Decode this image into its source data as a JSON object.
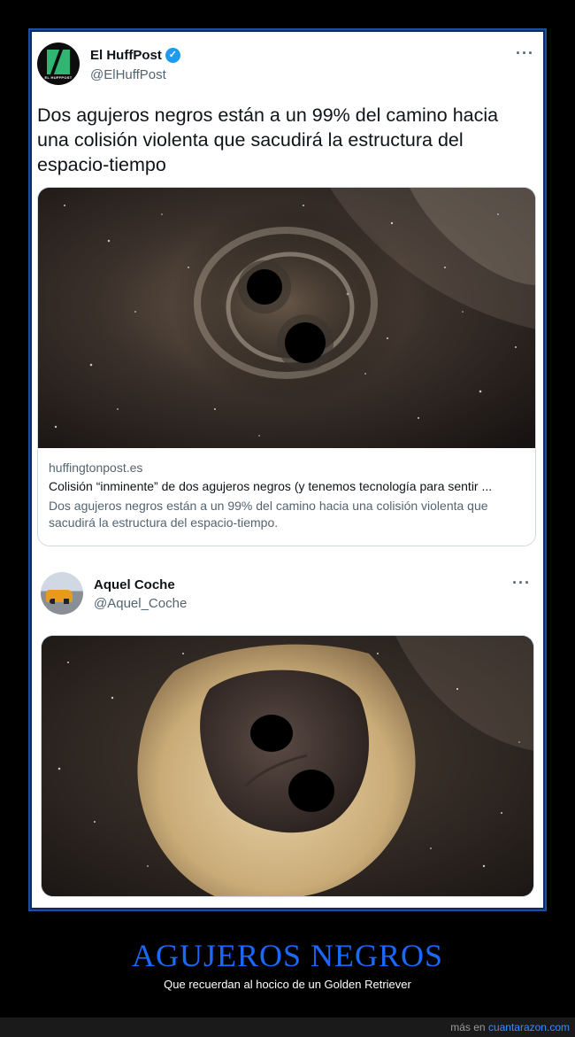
{
  "tweet1": {
    "name": "El HuffPost",
    "verified_mark": "✓",
    "handle": "@ElHuffPost",
    "more": "···",
    "avatar_small_text": "EL HUFFPOST",
    "text": "Dos agujeros negros están a un 99% del camino hacia una colisión violenta que sacudirá la estructura del espacio-tiempo",
    "link_card": {
      "domain": "huffingtonpost.es",
      "title": "Colisión “inminente” de dos agujeros negros (y tenemos tecnología para sentir ...",
      "description": "Dos agujeros negros están a un 99% del camino hacia una colisión violenta que sacudirá la estructura del espacio-tiempo."
    }
  },
  "tweet2": {
    "name": "Aquel Coche",
    "handle": "@Aquel_Coche",
    "more": "···"
  },
  "caption": {
    "title": "AGUJEROS NEGROS",
    "subtitle": "Que recuerdan al hocico de un Golden Retriever"
  },
  "footer": {
    "prefix": "más en",
    "site": "cuantarazon.com"
  },
  "colors": {
    "accent_blue": "#1a69ff",
    "verified_blue": "#1d9bf0",
    "huffpost_green": "#2fb672"
  },
  "icons": [
    "verified-badge-icon",
    "more-options-icon",
    "huffpost-logo-icon"
  ]
}
